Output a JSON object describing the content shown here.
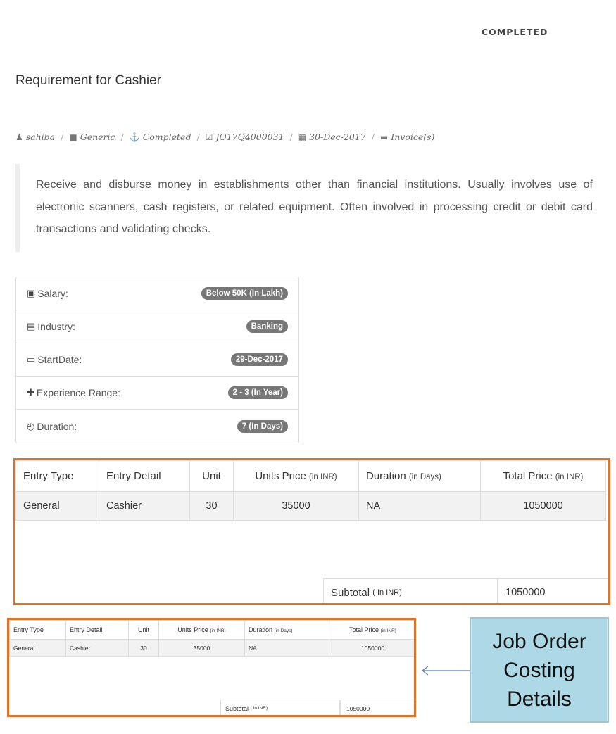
{
  "status": "COMPLETED",
  "title": "Requirement for Cashier",
  "meta": {
    "user": "sahiba",
    "category": "Generic",
    "state": "Completed",
    "job_id": "JO17Q4000031",
    "date": "30-Dec-2017",
    "invoice": "Invoice(s)"
  },
  "description": "Receive and disburse money in establishments other than financial institutions. Usually involves use of electronic scanners, cash registers, or related equipment. Often involved in processing credit or debit card transactions and validating checks.",
  "info": [
    {
      "icon": "money-icon",
      "glyph": "▣",
      "label": "Salary:",
      "value": "Below 50K  (In Lakh)"
    },
    {
      "icon": "building-icon",
      "glyph": "▤",
      "label": "Industry:",
      "value": "Banking"
    },
    {
      "icon": "keyboard-icon",
      "glyph": "▭",
      "label": "StartDate:",
      "value": "29-Dec-2017"
    },
    {
      "icon": "plus-icon",
      "glyph": "✚",
      "label": "Experience Range:",
      "value": "2 - 3   (In Year)"
    },
    {
      "icon": "clock-icon",
      "glyph": "◴",
      "label": "Duration:",
      "value": "7  (In Days)"
    }
  ],
  "costing": {
    "headers": {
      "entry_type": "Entry Type",
      "entry_detail": "Entry Detail",
      "unit": "Unit",
      "units_price": "Units Price",
      "units_price_unit": "(in INR)",
      "duration": "Duration",
      "duration_unit": "(in Days)",
      "total_price": "Total Price",
      "total_price_unit": "(in INR)"
    },
    "row": {
      "entry_type": "General",
      "entry_detail": "Cashier",
      "unit": "30",
      "units_price": "35000",
      "duration": "NA",
      "total_price": "1050000"
    },
    "subtotal_label": "Subtotal",
    "subtotal_unit": "( In INR)",
    "subtotal_value": "1050000"
  },
  "callout": {
    "line1": "Job Order",
    "line2": "Costing",
    "line3": "Details"
  }
}
